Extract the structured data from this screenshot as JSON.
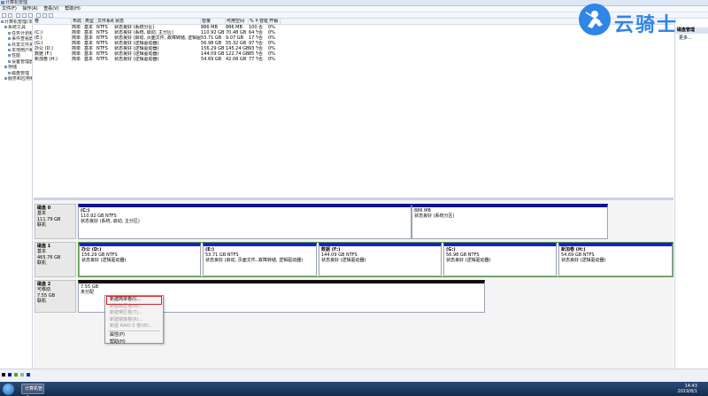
{
  "window": {
    "title": "计算机管理"
  },
  "menu": [
    "文件(F)",
    "操作(A)",
    "查看(V)",
    "帮助(H)"
  ],
  "tree": [
    {
      "label": "计算机管理(本地)",
      "indent": 0
    },
    {
      "label": "系统工具",
      "indent": 1
    },
    {
      "label": "任务计划程序",
      "indent": 2
    },
    {
      "label": "事件查看器",
      "indent": 2
    },
    {
      "label": "共享文件夹",
      "indent": 2
    },
    {
      "label": "本地用户和组",
      "indent": 2
    },
    {
      "label": "性能",
      "indent": 2
    },
    {
      "label": "设备管理器",
      "indent": 2
    },
    {
      "label": "存储",
      "indent": 1
    },
    {
      "label": "磁盘管理",
      "indent": 2
    },
    {
      "label": "服务和应用程序",
      "indent": 1
    }
  ],
  "volume_table": {
    "headers": [
      "卷",
      "布局",
      "类型",
      "文件系统",
      "状态",
      "容量",
      "可用空间",
      "% 可用",
      "容错",
      "开销"
    ],
    "rows": [
      [
        "",
        "简单",
        "基本",
        "NTFS",
        "状态良好 (系统分区)",
        "886 MB",
        "886 MB",
        "100 %",
        "否",
        "0%"
      ],
      [
        "(C:)",
        "简单",
        "基本",
        "NTFS",
        "状态良好 (系统, 启动, 主分区)",
        "110.92 GB",
        "70.48 GB",
        "64 %",
        "否",
        "0%"
      ],
      [
        "(E:)",
        "简单",
        "基本",
        "NTFS",
        "状态良好 (启动, 页面文件, 故障转储, 逻辑驱动器)",
        "53.71 GB",
        "9.07 GB",
        "17 %",
        "否",
        "0%"
      ],
      [
        "(G:)",
        "简单",
        "基本",
        "NTFS",
        "状态良好 (逻辑驱动器)",
        "56.98 GB",
        "55.32 GB",
        "97 %",
        "否",
        "0%"
      ],
      [
        "办公 (D:)",
        "简单",
        "基本",
        "NTFS",
        "状态良好 (逻辑驱动器)",
        "156.29 GB",
        "145.24 GB",
        "93 %",
        "否",
        "0%"
      ],
      [
        "数据 (F:)",
        "简单",
        "基本",
        "NTFS",
        "状态良好 (逻辑驱动器)",
        "144.09 GB",
        "122.74 GB",
        "85 %",
        "否",
        "0%"
      ],
      [
        "新加卷 (H:)",
        "简单",
        "基本",
        "NTFS",
        "状态良好 (逻辑驱动器)",
        "54.69 GB",
        "42.08 GB",
        "77 %",
        "否",
        "0%"
      ]
    ]
  },
  "disks": [
    {
      "name": "磁盘 0",
      "type": "基本",
      "size": "111.79 GB",
      "status": "联机",
      "volumes": [
        {
          "label": "(C:)",
          "size": "110.92 GB NTFS",
          "status": "状态良好 (系统, 启动, 主分区)"
        },
        {
          "label": "",
          "size": "886 MB",
          "status": "状态良好 (系统分区)"
        }
      ]
    },
    {
      "name": "磁盘 1",
      "type": "基本",
      "size": "465.76 GB",
      "status": "联机",
      "volumes": [
        {
          "label": "办公 (D:)",
          "size": "156.29 GB NTFS",
          "status": "状态良好 (逻辑驱动器)"
        },
        {
          "label": "(E:)",
          "size": "53.71 GB NTFS",
          "status": "状态良好 (启动, 页面文件, 故障转储, 逻辑驱动器)"
        },
        {
          "label": "数据 (F:)",
          "size": "144.09 GB NTFS",
          "status": "状态良好 (逻辑驱动器)"
        },
        {
          "label": "(G:)",
          "size": "56.98 GB NTFS",
          "status": "状态良好 (逻辑驱动器)"
        },
        {
          "label": "新加卷 (H:)",
          "size": "54.69 GB NTFS",
          "status": "状态良好 (逻辑驱动器)"
        }
      ]
    },
    {
      "name": "磁盘 2",
      "type": "可移动",
      "size": "7.55 GB",
      "status": "联机",
      "volumes": [
        {
          "label": "",
          "size": "7.55 GB",
          "status": "未分配"
        }
      ]
    }
  ],
  "context_menu": {
    "items": [
      {
        "label": "新建简单卷(I)...",
        "enabled": true,
        "highlight": true
      },
      {
        "label": "新建跨区卷(N)...",
        "enabled": false
      },
      {
        "label": "新建带区卷(T)...",
        "enabled": false
      },
      {
        "label": "新建镜像卷(R)...",
        "enabled": false
      },
      {
        "label": "新建 RAID-5 卷(W)...",
        "enabled": false
      },
      {
        "label": "属性(P)",
        "enabled": true
      },
      {
        "label": "帮助(H)",
        "enabled": true
      }
    ]
  },
  "actions_pane": {
    "header": "磁盘管理",
    "more": "更多..."
  },
  "logo": {
    "text": "云骑士",
    "color": "#2f86e6"
  },
  "taskbar": {
    "app_label": "计算机管理",
    "time": "14:43",
    "date": "2019/8/1"
  },
  "colors": {
    "primary_partition": "#12128e",
    "logical_drive": "#1a1ecf",
    "unallocated": "#111111",
    "extended": "#5b9e38",
    "highlight": "#d4232a"
  }
}
